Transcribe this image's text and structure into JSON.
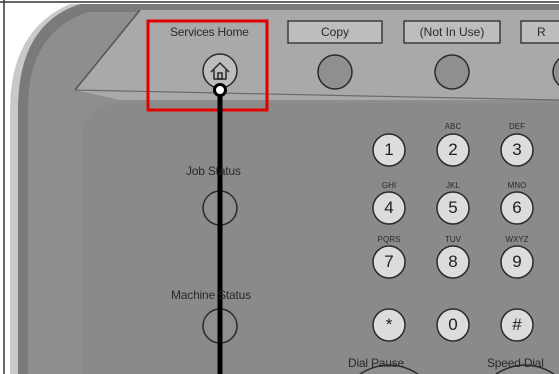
{
  "top_buttons": {
    "services_home": "Services Home",
    "copy": "Copy",
    "not_in_use": "(Not In Use)",
    "cut_off": "R"
  },
  "side_labels": {
    "job_status": "Job Status",
    "machine_status": "Machine Status"
  },
  "keypad": {
    "keys": [
      "1",
      "2",
      "3",
      "4",
      "5",
      "6",
      "7",
      "8",
      "9",
      "*",
      "0",
      "#"
    ],
    "letters": {
      "k2": "ABC",
      "k3": "DEF",
      "k4": "GHI",
      "k5": "JKL",
      "k6": "MNO",
      "k7": "PQRS",
      "k8": "TUV",
      "k9": "WXYZ"
    }
  },
  "bottom_labels": {
    "dial_pause": "Dial Pause",
    "speed_dial": "Speed Dial"
  },
  "colors": {
    "panel": "#8c8c8c",
    "panel_top": "#a9a9a9",
    "highlight": "#e00000",
    "key": "#dcdcdc"
  },
  "icons": [
    "home-icon",
    "asterisk-icon",
    "hash-icon"
  ]
}
